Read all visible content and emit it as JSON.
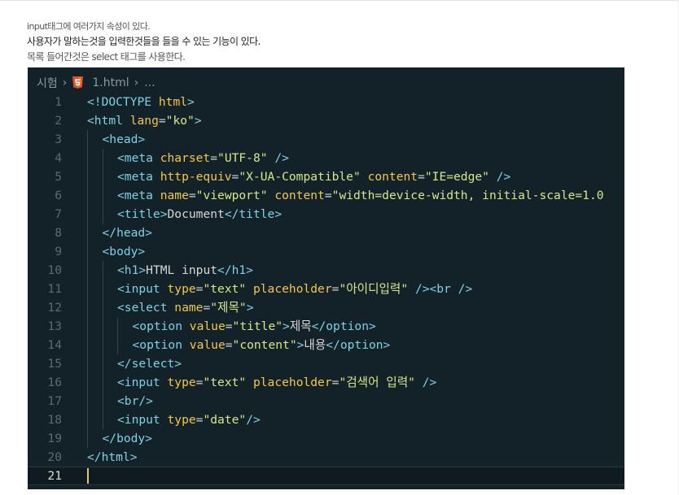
{
  "notes": [
    "input태그에 여러가지 속성이 있다.",
    "사용자가 말하는것을 입력한것들을 들을 수 있는 기능이 있다.",
    "목록 들어간것은 select 태그를 사용한다."
  ],
  "breadcrumb": {
    "folder": "시험",
    "separator": "›",
    "file_icon": "html5-icon",
    "file": "1.html",
    "ellipsis": "..."
  },
  "editor": {
    "current_line": 21,
    "colors": {
      "background": "#132128",
      "tag": "#7fd1e6",
      "attribute": "#f2c84b",
      "string": "#d6e88a",
      "text": "#d7d7d7",
      "line_number": "#5c6a72",
      "cursor": "#e9c46a"
    },
    "lines": [
      {
        "n": "1",
        "indent": 0,
        "tokens": [
          [
            "tag",
            "<!DOCTYPE "
          ],
          [
            "attr",
            "html"
          ],
          [
            "tag",
            ">"
          ]
        ]
      },
      {
        "n": "2",
        "indent": 0,
        "tokens": [
          [
            "tag",
            "<html "
          ],
          [
            "attr",
            "lang"
          ],
          [
            "punc",
            "="
          ],
          [
            "str",
            "\"ko\""
          ],
          [
            "tag",
            ">"
          ]
        ]
      },
      {
        "n": "3",
        "indent": 1,
        "tokens": [
          [
            "tag",
            "<head>"
          ]
        ]
      },
      {
        "n": "4",
        "indent": 2,
        "tokens": [
          [
            "tag",
            "<meta "
          ],
          [
            "attr",
            "charset"
          ],
          [
            "punc",
            "="
          ],
          [
            "str",
            "\"UTF-8\""
          ],
          [
            "text",
            " "
          ],
          [
            "tag",
            "/>"
          ]
        ]
      },
      {
        "n": "5",
        "indent": 2,
        "tokens": [
          [
            "tag",
            "<meta "
          ],
          [
            "attr",
            "http-equiv"
          ],
          [
            "punc",
            "="
          ],
          [
            "str",
            "\"X-UA-Compatible\""
          ],
          [
            "text",
            " "
          ],
          [
            "attr",
            "content"
          ],
          [
            "punc",
            "="
          ],
          [
            "str",
            "\"IE=edge\""
          ],
          [
            "text",
            " "
          ],
          [
            "tag",
            "/>"
          ]
        ]
      },
      {
        "n": "6",
        "indent": 2,
        "tokens": [
          [
            "tag",
            "<meta "
          ],
          [
            "attr",
            "name"
          ],
          [
            "punc",
            "="
          ],
          [
            "str",
            "\"viewport\""
          ],
          [
            "text",
            " "
          ],
          [
            "attr",
            "content"
          ],
          [
            "punc",
            "="
          ],
          [
            "str",
            "\"width=device-width, initial-scale=1.0"
          ]
        ]
      },
      {
        "n": "7",
        "indent": 2,
        "tokens": [
          [
            "tag",
            "<title>"
          ],
          [
            "text",
            "Document"
          ],
          [
            "tag",
            "</title>"
          ]
        ]
      },
      {
        "n": "8",
        "indent": 1,
        "tokens": [
          [
            "tag",
            "</head>"
          ]
        ]
      },
      {
        "n": "9",
        "indent": 1,
        "tokens": [
          [
            "tag",
            "<body>"
          ]
        ]
      },
      {
        "n": "10",
        "indent": 2,
        "tokens": [
          [
            "tag",
            "<h1>"
          ],
          [
            "text",
            "HTML input"
          ],
          [
            "tag",
            "</h1>"
          ]
        ]
      },
      {
        "n": "11",
        "indent": 2,
        "tokens": [
          [
            "tag",
            "<input "
          ],
          [
            "attr",
            "type"
          ],
          [
            "punc",
            "="
          ],
          [
            "str",
            "\"text\""
          ],
          [
            "text",
            " "
          ],
          [
            "attr",
            "placeholder"
          ],
          [
            "punc",
            "="
          ],
          [
            "str",
            "\"아이디입력\""
          ],
          [
            "text",
            " "
          ],
          [
            "tag",
            "/><br />"
          ]
        ]
      },
      {
        "n": "12",
        "indent": 2,
        "tokens": [
          [
            "tag",
            "<select "
          ],
          [
            "attr",
            "name"
          ],
          [
            "punc",
            "="
          ],
          [
            "str",
            "\"제목\""
          ],
          [
            "tag",
            ">"
          ]
        ]
      },
      {
        "n": "13",
        "indent": 3,
        "tokens": [
          [
            "tag",
            "<option "
          ],
          [
            "attr",
            "value"
          ],
          [
            "punc",
            "="
          ],
          [
            "str",
            "\"title\""
          ],
          [
            "tag",
            ">"
          ],
          [
            "text",
            "제목"
          ],
          [
            "tag",
            "</option>"
          ]
        ]
      },
      {
        "n": "14",
        "indent": 3,
        "tokens": [
          [
            "tag",
            "<option "
          ],
          [
            "attr",
            "value"
          ],
          [
            "punc",
            "="
          ],
          [
            "str",
            "\"content\""
          ],
          [
            "tag",
            ">"
          ],
          [
            "text",
            "내용"
          ],
          [
            "tag",
            "</option>"
          ]
        ]
      },
      {
        "n": "15",
        "indent": 2,
        "tokens": [
          [
            "tag",
            "</select>"
          ]
        ]
      },
      {
        "n": "16",
        "indent": 2,
        "tokens": [
          [
            "tag",
            "<input "
          ],
          [
            "attr",
            "type"
          ],
          [
            "punc",
            "="
          ],
          [
            "str",
            "\"text\""
          ],
          [
            "text",
            " "
          ],
          [
            "attr",
            "placeholder"
          ],
          [
            "punc",
            "="
          ],
          [
            "str",
            "\"검색어 입력\""
          ],
          [
            "text",
            " "
          ],
          [
            "tag",
            "/>"
          ]
        ]
      },
      {
        "n": "17",
        "indent": 2,
        "tokens": [
          [
            "tag",
            "<br/>"
          ]
        ]
      },
      {
        "n": "18",
        "indent": 2,
        "tokens": [
          [
            "tag",
            "<input "
          ],
          [
            "attr",
            "type"
          ],
          [
            "punc",
            "="
          ],
          [
            "str",
            "\"date\""
          ],
          [
            "tag",
            "/>"
          ]
        ]
      },
      {
        "n": "19",
        "indent": 1,
        "tokens": [
          [
            "tag",
            "</body>"
          ]
        ]
      },
      {
        "n": "20",
        "indent": 0,
        "tokens": [
          [
            "tag",
            "</html>"
          ]
        ]
      },
      {
        "n": "21",
        "indent": 0,
        "tokens": []
      }
    ]
  }
}
